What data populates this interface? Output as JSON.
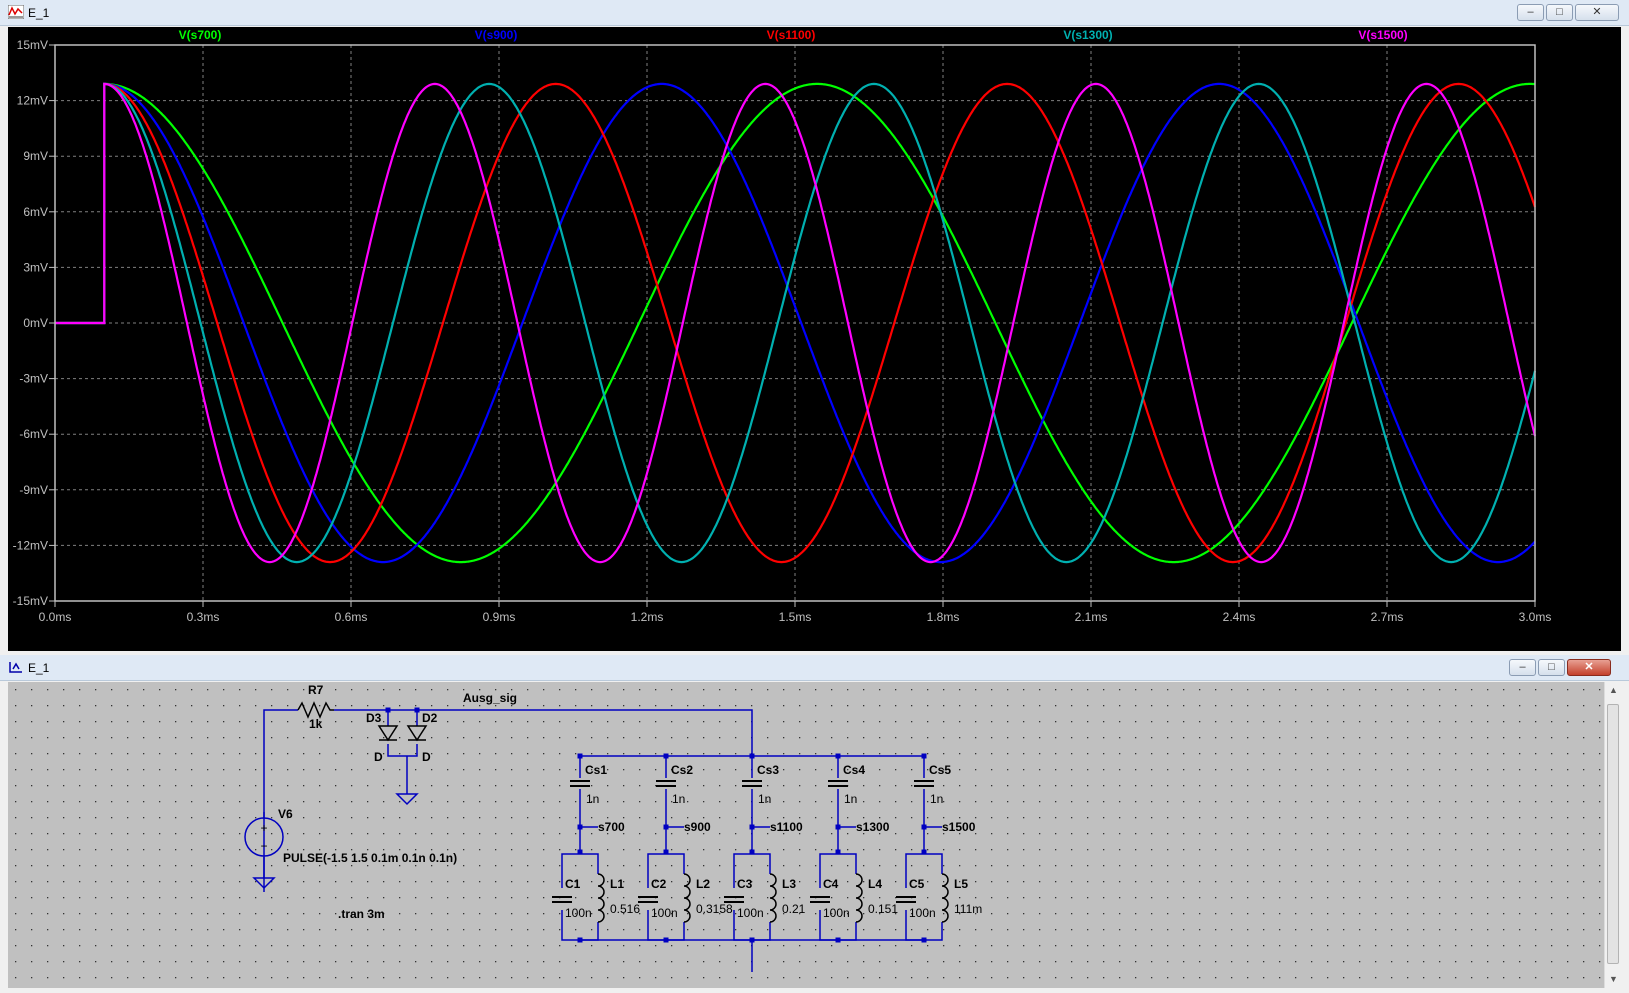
{
  "plot_window": {
    "title": "E_1",
    "buttons": {
      "minimize": "–",
      "maximize": "□",
      "close": "✕"
    }
  },
  "schematic_window": {
    "title": "E_1",
    "buttons": {
      "minimize": "–",
      "maximize": "□",
      "close": "✕"
    }
  },
  "colors": {
    "s700": "#00ff00",
    "s900": "#0000ff",
    "s1100": "#ff0000",
    "s1300": "#00b0b0",
    "s1500": "#ff00ff",
    "plot_background": "#000000",
    "grid": "#808080",
    "wire": "#0000c0",
    "schematic_background": "#c0c0c0"
  },
  "chart_data": {
    "type": "line",
    "title": "",
    "xlabel": "",
    "ylabel": "",
    "xlim": [
      0,
      3.0
    ],
    "ylim": [
      -15,
      15
    ],
    "x_unit": "ms",
    "y_unit": "mV",
    "x_ticks": [
      "0.0ms",
      "0.3ms",
      "0.6ms",
      "0.9ms",
      "1.2ms",
      "1.5ms",
      "1.8ms",
      "2.1ms",
      "2.4ms",
      "2.7ms",
      "3.0ms"
    ],
    "y_ticks": [
      "15mV",
      "12mV",
      "9mV",
      "6mV",
      "3mV",
      "0mV",
      "-3mV",
      "-6mV",
      "-9mV",
      "-12mV",
      "-15mV"
    ],
    "grid": true,
    "legend_placement": "top",
    "amplitude_mV": 12.9,
    "step_time_ms": 0.1,
    "series": [
      {
        "name": "V(s700)",
        "color": "#00ff00",
        "period_ms": 1.445,
        "end_value_mV": 12.8
      },
      {
        "name": "V(s900)",
        "color": "#0000ff",
        "period_ms": 1.13,
        "end_value_mV": -11.2
      },
      {
        "name": "V(s1100)",
        "color": "#ff0000",
        "period_ms": 0.915,
        "end_value_mV": 6.4
      },
      {
        "name": "V(s1300)",
        "color": "#00b0b0",
        "period_ms": 0.78,
        "end_value_mV": -1.3
      },
      {
        "name": "V(s1500)",
        "color": "#ff00ff",
        "period_ms": 0.67,
        "end_value_mV": -7.8
      }
    ]
  },
  "schematic": {
    "net_label": "Ausg_sig",
    "resistor": {
      "name": "R7",
      "value": "1k"
    },
    "diodes": [
      {
        "name": "D3",
        "model": "D"
      },
      {
        "name": "D2",
        "model": "D"
      }
    ],
    "source": {
      "name": "V6",
      "value": "PULSE(-1.5 1.5 0.1m 0.1n 0.1n)"
    },
    "directive": ".tran 3m",
    "branches": [
      {
        "cs": "Cs1",
        "cs_value": "1n",
        "node": "s700",
        "c": "C1",
        "c_value": "100n",
        "l": "L1",
        "l_value": "0.516"
      },
      {
        "cs": "Cs2",
        "cs_value": "1n",
        "node": "s900",
        "c": "C2",
        "c_value": "100n",
        "l": "L2",
        "l_value": "0.3158"
      },
      {
        "cs": "Cs3",
        "cs_value": "1n",
        "node": "s1100",
        "c": "C3",
        "c_value": "100n",
        "l": "L3",
        "l_value": "0.21"
      },
      {
        "cs": "Cs4",
        "cs_value": "1n",
        "node": "s1300",
        "c": "C4",
        "c_value": "100n",
        "l": "L4",
        "l_value": "0.151"
      },
      {
        "cs": "Cs5",
        "cs_value": "1n",
        "node": "s1500",
        "c": "C5",
        "c_value": "100n",
        "l": "L5",
        "l_value": "111m"
      }
    ]
  }
}
